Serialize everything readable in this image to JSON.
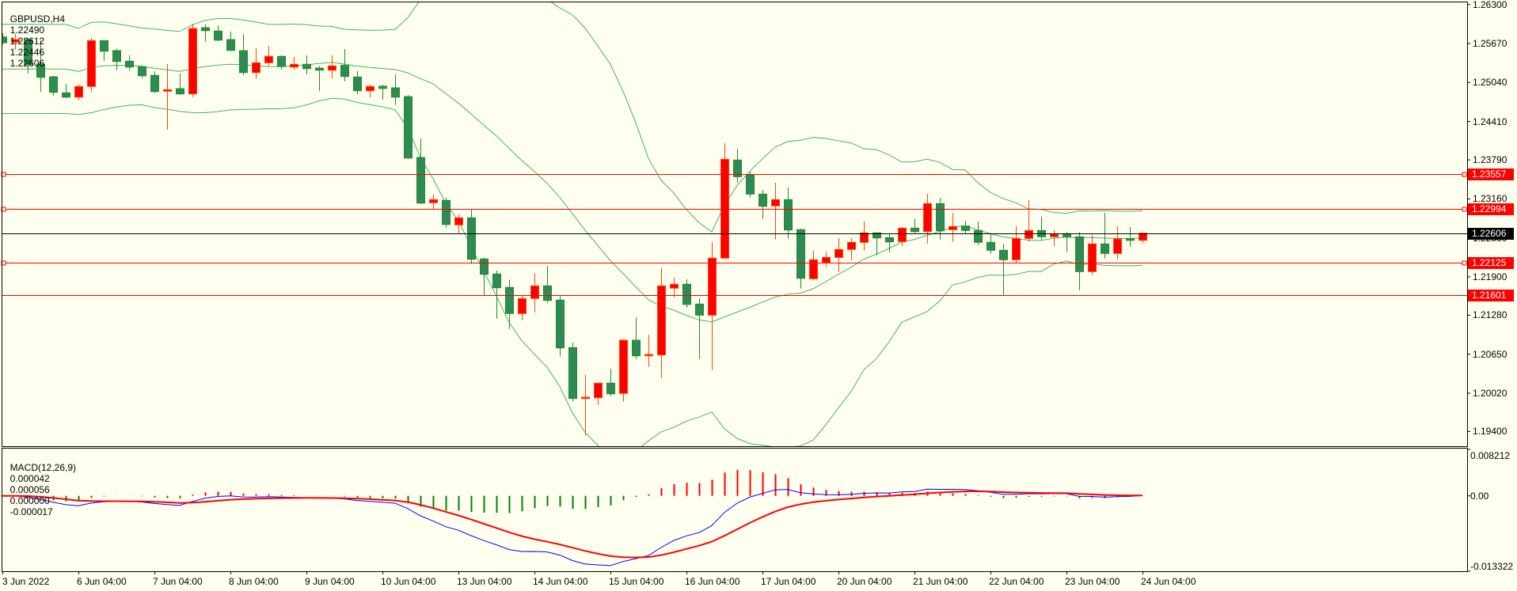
{
  "chart_header": {
    "symbol_tf": "GBPUSD,H4",
    "open": "1.22490",
    "high": "1.22612",
    "low": "1.22446",
    "close": "1.22606"
  },
  "macd_header": {
    "label": "MACD(12,26,9)",
    "values": [
      "0.000042",
      "0.000056",
      "0.000000",
      "-0.000017"
    ]
  },
  "price_axis": [
    "1.26300",
    "1.25670",
    "1.25040",
    "1.24410",
    "1.23790",
    "1.23160",
    "1.22530",
    "1.21900",
    "1.21280",
    "1.20650",
    "1.20020",
    "1.19400"
  ],
  "macd_axis": [
    "0.008212",
    "0.00",
    "-0.013322"
  ],
  "time_axis": [
    "3 Jun 2022",
    "6 Jun 04:00",
    "7 Jun 04:00",
    "8 Jun 04:00",
    "9 Jun 04:00",
    "10 Jun 04:00",
    "13 Jun 04:00",
    "14 Jun 04:00",
    "15 Jun 04:00",
    "16 Jun 04:00",
    "17 Jun 04:00",
    "20 Jun 04:00",
    "21 Jun 04:00",
    "22 Jun 04:00",
    "23 Jun 04:00",
    "24 Jun 04:00"
  ],
  "levels": [
    {
      "price": "1.23557",
      "color": "#ff0000",
      "handles": true
    },
    {
      "price": "1.22994",
      "color": "#ff0000",
      "handles": true
    },
    {
      "price": "1.22606",
      "color": "#000000",
      "handles": false
    },
    {
      "price": "1.22125",
      "color": "#ff0000",
      "handles": true
    },
    {
      "price": "1.21601",
      "color": "#ff0000",
      "handles": false
    }
  ],
  "colors": {
    "background": "#fffff0",
    "bear_body": "#2e8b57",
    "bear_outline": "#228b22",
    "bull_body": "#ff0000",
    "bull_outline": "#ff4500",
    "bands": "#3cb371",
    "macd_line": "#0000ff",
    "signal_line": "#ff0000",
    "hist_positive": "#ff0000",
    "hist_negative": "#008000"
  },
  "chart_data": {
    "type": "candlestick",
    "symbol": "GBPUSD",
    "timeframe": "H4",
    "ylim": [
      1.194,
      1.263
    ],
    "macd_ylim": [
      -0.013322,
      0.008212
    ],
    "indicators": [
      "Bollinger Bands",
      "MACD(12,26,9)"
    ],
    "ohlc": [
      [
        1.25776,
        1.25836,
        1.25657,
        1.25683
      ],
      [
        1.25692,
        1.25827,
        1.25571,
        1.25734
      ],
      [
        1.25734,
        1.25759,
        1.25188,
        1.25329
      ],
      [
        1.25338,
        1.25721,
        1.2489,
        1.25124
      ],
      [
        1.25133,
        1.2515,
        1.2483,
        1.24881
      ],
      [
        1.24873,
        1.25018,
        1.24788,
        1.24804
      ],
      [
        1.24804,
        1.25009,
        1.24753,
        1.24976
      ],
      [
        1.24976,
        1.25759,
        1.24881,
        1.25717
      ],
      [
        1.25717,
        1.25717,
        1.25393,
        1.25546
      ],
      [
        1.25555,
        1.25589,
        1.25235,
        1.2538
      ],
      [
        1.25385,
        1.25478,
        1.25235,
        1.2529
      ],
      [
        1.25295,
        1.25316,
        1.25107,
        1.2515
      ],
      [
        1.25155,
        1.25222,
        1.24873,
        1.24894
      ],
      [
        1.24899,
        1.25338,
        1.24276,
        1.24925
      ],
      [
        1.24941,
        1.25184,
        1.24839,
        1.24856
      ],
      [
        1.24856,
        1.2599,
        1.24804,
        1.25913
      ],
      [
        1.25926,
        1.25977,
        1.25699,
        1.25878
      ],
      [
        1.25871,
        1.25964,
        1.25708,
        1.25725
      ],
      [
        1.25734,
        1.25862,
        1.25546,
        1.25559
      ],
      [
        1.25555,
        1.2582,
        1.25159,
        1.25201
      ],
      [
        1.25201,
        1.25593,
        1.25107,
        1.25359
      ],
      [
        1.25359,
        1.25632,
        1.25303,
        1.25462
      ],
      [
        1.25462,
        1.25478,
        1.25252,
        1.25299
      ],
      [
        1.2529,
        1.25453,
        1.25248,
        1.25334
      ],
      [
        1.25334,
        1.25478,
        1.25171,
        1.25265
      ],
      [
        1.25274,
        1.25308,
        1.24903,
        1.25239
      ],
      [
        1.25239,
        1.25478,
        1.25107,
        1.25308
      ],
      [
        1.25316,
        1.2558,
        1.2506,
        1.25137
      ],
      [
        1.25129,
        1.25222,
        1.24852,
        1.24907
      ],
      [
        1.24907,
        1.25009,
        1.24801,
        1.24976
      ],
      [
        1.2498,
        1.25005,
        1.24762,
        1.24945
      ],
      [
        1.24954,
        1.25171,
        1.24677,
        1.24804
      ],
      [
        1.24813,
        1.24839,
        1.23807,
        1.2382
      ],
      [
        1.23829,
        1.24136,
        1.23079,
        1.23091
      ],
      [
        1.23097,
        1.23228,
        1.22998,
        1.23148
      ],
      [
        1.23135,
        1.23177,
        1.22695,
        1.22746
      ],
      [
        1.22739,
        1.22909,
        1.22602,
        1.22854
      ],
      [
        1.22854,
        1.22994,
        1.22107,
        1.22184
      ],
      [
        1.22189,
        1.22214,
        1.21601,
        1.21941
      ],
      [
        1.21946,
        1.22001,
        1.21225,
        1.21724
      ],
      [
        1.21729,
        1.21856,
        1.21059,
        1.21307
      ],
      [
        1.21307,
        1.21592,
        1.21199,
        1.2155
      ],
      [
        1.2155,
        1.21959,
        1.21327,
        1.21754
      ],
      [
        1.21754,
        1.22078,
        1.21477,
        1.21519
      ],
      [
        1.21524,
        1.21592,
        1.20611,
        1.20752
      ],
      [
        1.20757,
        1.20834,
        1.19888,
        1.19934
      ],
      [
        1.19934,
        1.20313,
        1.19333,
        1.19955
      ],
      [
        1.19946,
        1.20182,
        1.19831,
        1.20182
      ],
      [
        1.20182,
        1.20416,
        1.19972,
        1.2001
      ],
      [
        1.20016,
        1.20889,
        1.19883,
        1.20876
      ],
      [
        1.20876,
        1.21243,
        1.20573,
        1.20624
      ],
      [
        1.20624,
        1.20962,
        1.20445,
        1.20646
      ],
      [
        1.20637,
        1.22039,
        1.20266,
        1.21754
      ],
      [
        1.21716,
        1.21886,
        1.2157,
        1.2178
      ],
      [
        1.2178,
        1.2186,
        1.21404,
        1.21455
      ],
      [
        1.2146,
        1.21553,
        1.20573,
        1.21281
      ],
      [
        1.21281,
        1.22461,
        1.20394,
        1.22202
      ],
      [
        1.22202,
        1.24059,
        1.22202,
        1.238
      ],
      [
        1.23787,
        1.2397,
        1.23424,
        1.23518
      ],
      [
        1.23548,
        1.23603,
        1.23181,
        1.23237
      ],
      [
        1.23237,
        1.23305,
        1.22836,
        1.2304
      ],
      [
        1.23045,
        1.2342,
        1.22503,
        1.23148
      ],
      [
        1.23148,
        1.23343,
        1.22516,
        1.22657
      ],
      [
        1.22662,
        1.22678,
        1.21711,
        1.21877
      ],
      [
        1.21869,
        1.22321,
        1.21851,
        1.22176
      ],
      [
        1.22133,
        1.22308,
        1.22056,
        1.22214
      ],
      [
        1.22214,
        1.22525,
        1.21979,
        1.22342
      ],
      [
        1.22342,
        1.22525,
        1.22167,
        1.22457
      ],
      [
        1.22457,
        1.22794,
        1.22324,
        1.22611
      ],
      [
        1.22611,
        1.22611,
        1.22248,
        1.22529
      ],
      [
        1.22534,
        1.22593,
        1.22299,
        1.22465
      ],
      [
        1.2247,
        1.22708,
        1.22397,
        1.22687
      ],
      [
        1.22687,
        1.22836,
        1.22606,
        1.22631
      ],
      [
        1.22631,
        1.23241,
        1.22439,
        1.23084
      ],
      [
        1.23084,
        1.23177,
        1.22503,
        1.22644
      ],
      [
        1.22662,
        1.22934,
        1.22465,
        1.22713
      ],
      [
        1.22721,
        1.22806,
        1.22593,
        1.22649
      ],
      [
        1.22649,
        1.22794,
        1.22414,
        1.22457
      ],
      [
        1.22457,
        1.22606,
        1.22273,
        1.22329
      ],
      [
        1.22329,
        1.22432,
        1.21601,
        1.22176
      ],
      [
        1.22176,
        1.22717,
        1.22129,
        1.22521
      ],
      [
        1.22521,
        1.23139,
        1.22465,
        1.22649
      ],
      [
        1.22649,
        1.2287,
        1.22496,
        1.22547
      ],
      [
        1.22547,
        1.22653,
        1.22397,
        1.22589
      ],
      [
        1.22589,
        1.22623,
        1.22299,
        1.22551
      ],
      [
        1.22547,
        1.22623,
        1.21685,
        1.21984
      ],
      [
        1.21984,
        1.2258,
        1.21928,
        1.22432
      ],
      [
        1.22432,
        1.22934,
        1.22196,
        1.22278
      ],
      [
        1.22278,
        1.22717,
        1.22184,
        1.22512
      ],
      [
        1.22516,
        1.22704,
        1.22388,
        1.2249
      ],
      [
        1.2249,
        1.22612,
        1.22446,
        1.22606
      ]
    ]
  }
}
